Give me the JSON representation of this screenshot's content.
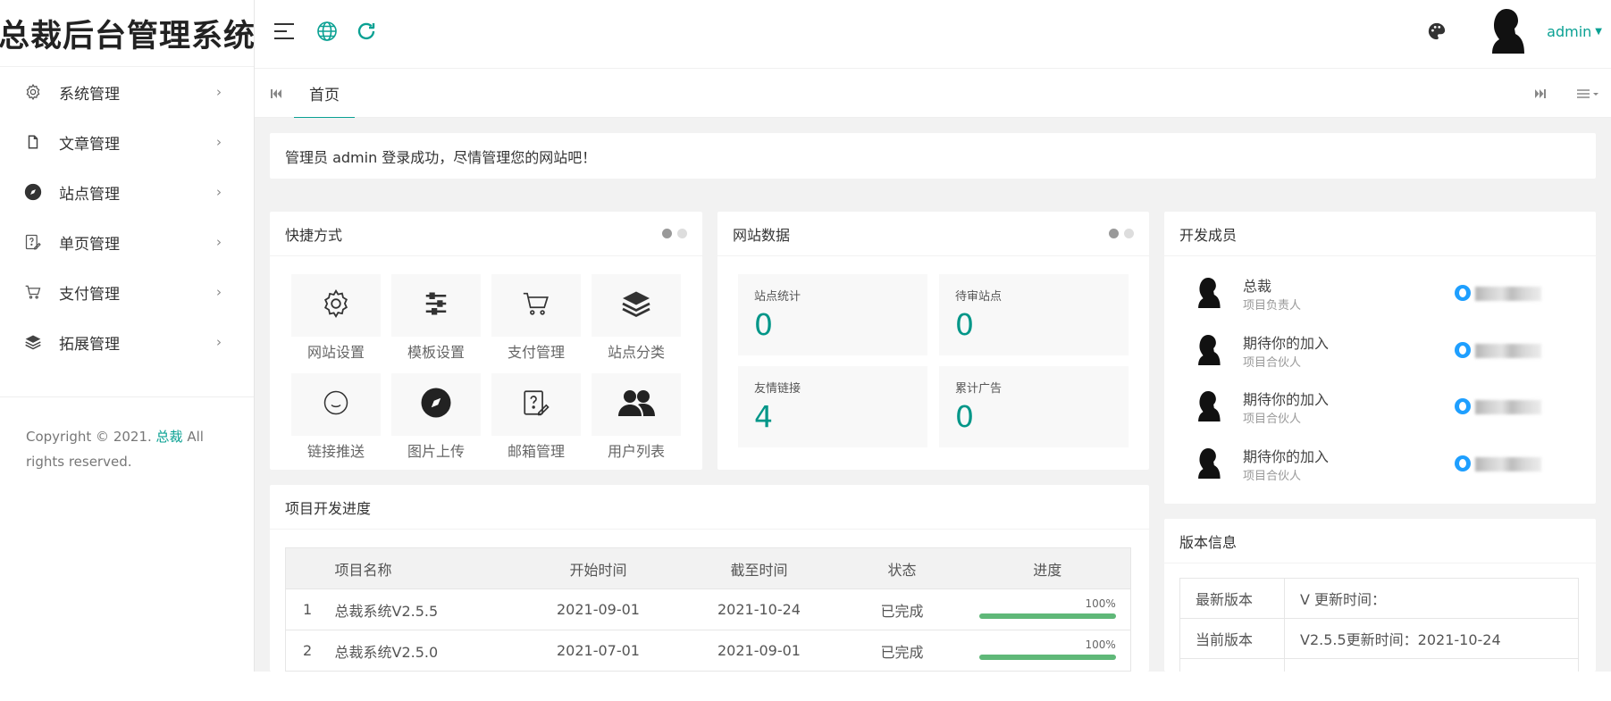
{
  "app": {
    "title": "总裁后台管理系统"
  },
  "sidebar": {
    "items": [
      {
        "label": "系统管理",
        "icon": "gear-icon"
      },
      {
        "label": "文章管理",
        "icon": "file-icon"
      },
      {
        "label": "站点管理",
        "icon": "compass-icon"
      },
      {
        "label": "单页管理",
        "icon": "edit-page-icon"
      },
      {
        "label": "支付管理",
        "icon": "cart-icon"
      },
      {
        "label": "拓展管理",
        "icon": "layers-icon"
      }
    ],
    "arrow": "›",
    "copyright_prefix": "Copyright © 2021. ",
    "copyright_link": "总裁",
    "copyright_suffix": " All rights reserved."
  },
  "header": {
    "user": "admin",
    "accent": "#0aa193"
  },
  "tabs": {
    "home": "首页"
  },
  "notice": "管理员 admin 登录成功，尽情管理您的网站吧！",
  "shortcuts": {
    "title": "快捷方式",
    "items": [
      {
        "label": "网站设置",
        "icon": "gear-icon"
      },
      {
        "label": "模板设置",
        "icon": "sliders-icon"
      },
      {
        "label": "支付管理",
        "icon": "cart-icon"
      },
      {
        "label": "站点分类",
        "icon": "layers-icon"
      },
      {
        "label": "链接推送",
        "icon": "chat-bubble-icon"
      },
      {
        "label": "图片上传",
        "icon": "compass-icon"
      },
      {
        "label": "邮箱管理",
        "icon": "edit-page-icon"
      },
      {
        "label": "用户列表",
        "icon": "users-icon"
      }
    ]
  },
  "site_data": {
    "title": "网站数据",
    "stats": [
      {
        "label": "站点统计",
        "value": "0"
      },
      {
        "label": "待审站点",
        "value": "0"
      },
      {
        "label": "友情链接",
        "value": "4"
      },
      {
        "label": "累计广告",
        "value": "0"
      }
    ]
  },
  "members": {
    "title": "开发成员",
    "items": [
      {
        "name": "总裁",
        "role": "项目负责人"
      },
      {
        "name": "期待你的加入",
        "role": "项目合伙人"
      },
      {
        "name": "期待你的加入",
        "role": "项目合伙人"
      },
      {
        "name": "期待你的加入",
        "role": "项目合伙人"
      }
    ]
  },
  "progress": {
    "title": "项目开发进度",
    "columns": [
      "",
      "项目名称",
      "开始时间",
      "截至时间",
      "状态",
      "进度"
    ],
    "rows": [
      {
        "no": "1",
        "name": "总裁系统V2.5.5",
        "start": "2021-09-01",
        "end": "2021-10-24",
        "status": "已完成",
        "status_color": "red",
        "pct_label": "100%",
        "pct": 1.0
      },
      {
        "no": "2",
        "name": "总裁系统V2.5.0",
        "start": "2021-07-01",
        "end": "2021-09-01",
        "status": "已完成",
        "status_color": "green",
        "pct_label": "100%",
        "pct": 1.0
      }
    ]
  },
  "version": {
    "title": "版本信息",
    "rows": [
      {
        "k": "最新版本",
        "v": "V 更新时间："
      },
      {
        "k": "当前版本",
        "v": "V2.5.5更新时间：2021-10-24"
      }
    ]
  }
}
